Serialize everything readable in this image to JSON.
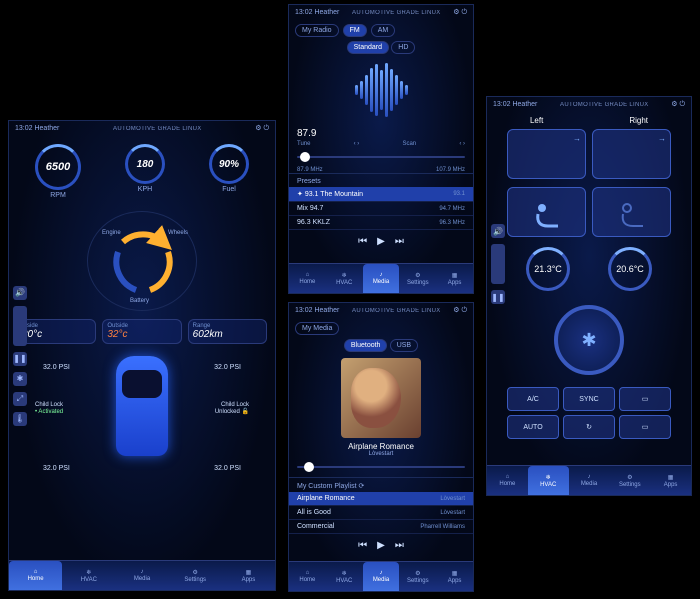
{
  "header": {
    "time": "13:02",
    "user": "Heather",
    "brand": "AUTOMOTIVE GRADE LINUX"
  },
  "nav": {
    "items": [
      {
        "label": "Home",
        "icon": "home"
      },
      {
        "label": "HVAC",
        "icon": "hvac"
      },
      {
        "label": "Media",
        "icon": "media"
      },
      {
        "label": "Settings",
        "icon": "settings"
      },
      {
        "label": "Apps",
        "icon": "apps"
      }
    ]
  },
  "dashboard": {
    "gauges": [
      {
        "value": "6500",
        "label": "RPM"
      },
      {
        "value": "180",
        "label": "KPH"
      },
      {
        "value": "90%",
        "label": "Fuel"
      }
    ],
    "cycle": {
      "engine": "Engine",
      "wheels": "Wheels",
      "battery": "Battery"
    },
    "stats": {
      "inside": {
        "label": "Inside",
        "value": "20°c"
      },
      "outside": {
        "label": "Outside",
        "value": "32°c"
      },
      "range": {
        "label": "Range",
        "value": "602km"
      }
    },
    "tires": {
      "fl": "32.0 PSI",
      "fr": "32.0 PSI",
      "rl": "32.0 PSI",
      "rr": "32.0 PSI"
    },
    "childlock": {
      "left": {
        "label": "Child Lock",
        "state": "• Activated"
      },
      "right": {
        "label": "Child Lock",
        "state": "Unlocked 🔓"
      }
    }
  },
  "radio": {
    "tab": "My Radio",
    "bands": {
      "standard": "Standard",
      "hd": "HD"
    },
    "mode": {
      "fm": "FM",
      "am": "AM"
    },
    "freq": "87.9",
    "tune": {
      "tune": "Tune",
      "scan": "Scan"
    },
    "range": {
      "low": "87.9 MHz",
      "high": "107.9 MHz"
    },
    "presets_label": "Presets",
    "presets": [
      {
        "name": "93.1 The Mountain",
        "freq": "93.1"
      },
      {
        "name": "Mix 94.7",
        "freq": "94.7 MHz"
      },
      {
        "name": "96.3 KKLZ",
        "freq": "96.3 MHz"
      }
    ]
  },
  "media": {
    "tab": "My Media",
    "sources": {
      "bt": "Bluetooth",
      "usb": "USB"
    },
    "track": {
      "title": "Airplane Romance",
      "artist": "Lòvestart"
    },
    "playlist_label": "My Custom Playlist",
    "playlist": [
      {
        "title": "Airplane Romance",
        "tag": "Lòvestart"
      },
      {
        "title": "All is Good",
        "tag": "Lòvestart"
      },
      {
        "title": "Commercial",
        "tag": "Pharrell Williams"
      }
    ]
  },
  "hvac": {
    "left": "Left",
    "right": "Right",
    "temp_left": "21.3°C",
    "temp_right": "20.6°C",
    "buttons": {
      "ac": "A/C",
      "sync": "SYNC",
      "auto": "AUTO"
    }
  }
}
